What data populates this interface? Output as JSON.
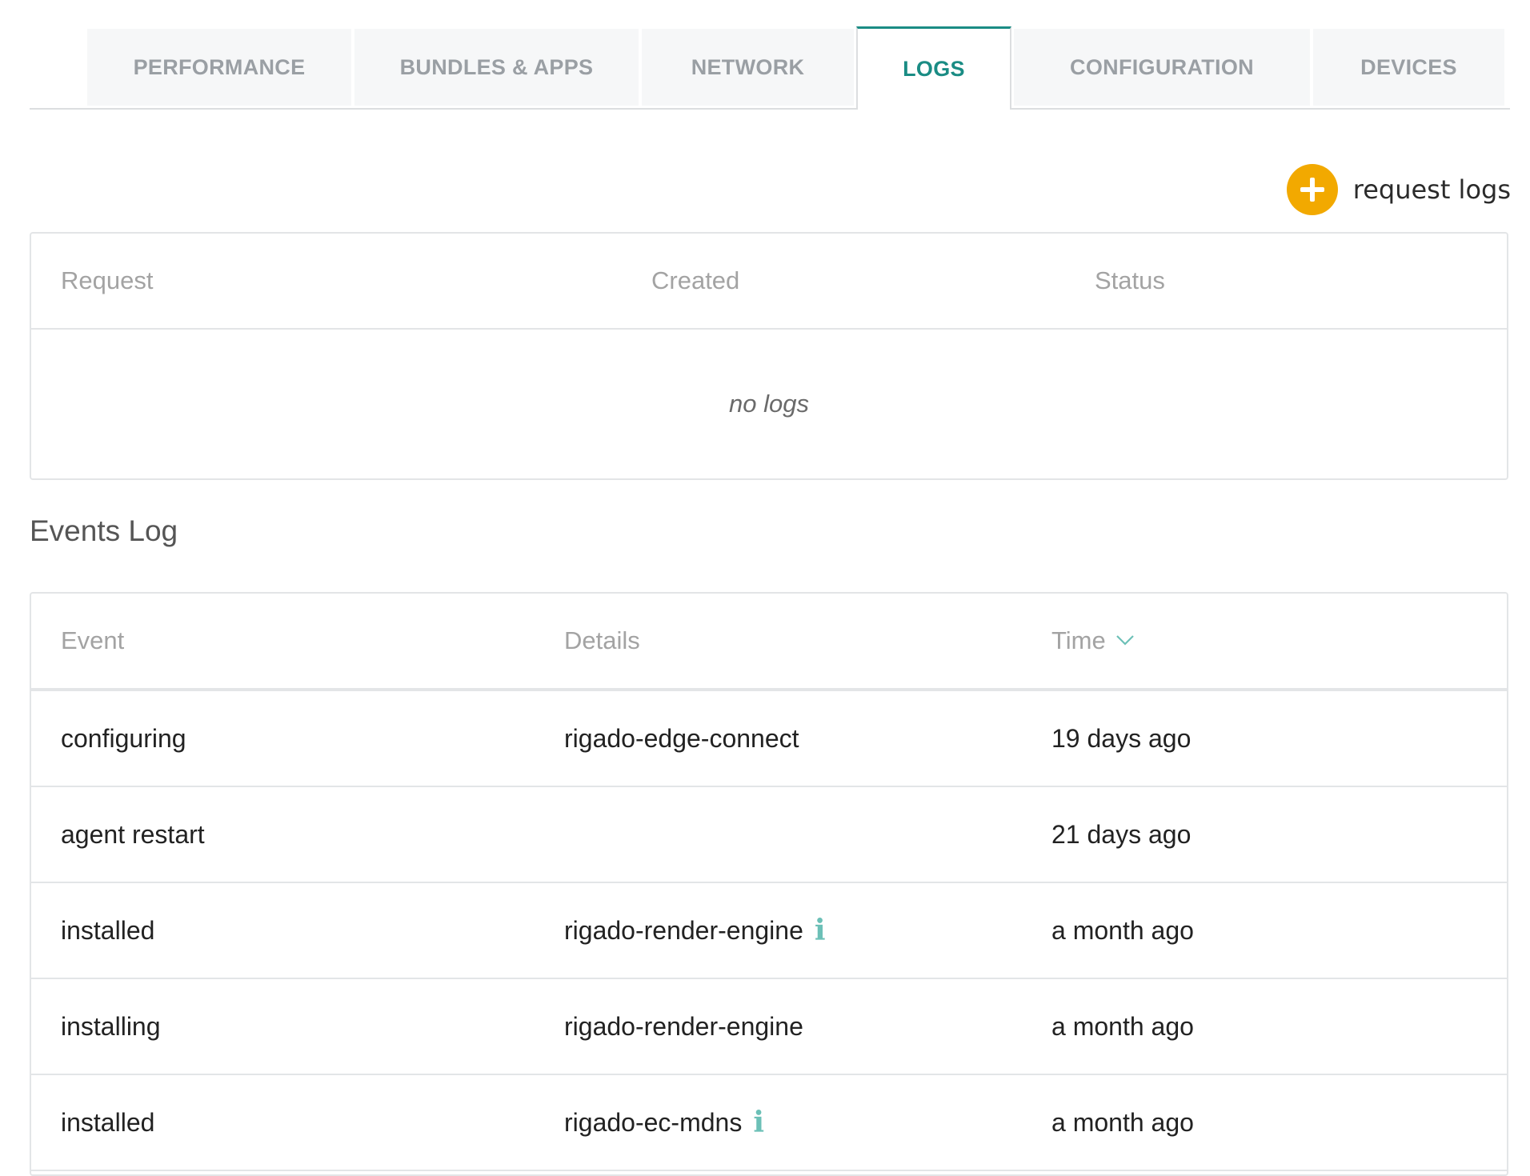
{
  "tabs": [
    {
      "label": "PERFORMANCE",
      "active": false
    },
    {
      "label": "BUNDLES & APPS",
      "active": false
    },
    {
      "label": "NETWORK",
      "active": false
    },
    {
      "label": "LOGS",
      "active": true
    },
    {
      "label": "CONFIGURATION",
      "active": false
    },
    {
      "label": "DEVICES",
      "active": false
    }
  ],
  "actions": {
    "request_logs_label": "request logs",
    "request_logs_icon": "plus-circle-icon"
  },
  "logs_table": {
    "columns": [
      "Request",
      "Created",
      "Status"
    ],
    "empty_text": "no logs"
  },
  "events": {
    "title": "Events Log",
    "columns": [
      "Event",
      "Details",
      "Time"
    ],
    "sort_icon": "chevron-down-icon",
    "rows": [
      {
        "event": "configuring",
        "details": "rigado-edge-connect",
        "time": "19 days ago",
        "info": false
      },
      {
        "event": "agent restart",
        "details": "",
        "time": "21 days ago",
        "info": false
      },
      {
        "event": "installed",
        "details": "rigado-render-engine",
        "time": "a month ago",
        "info": true
      },
      {
        "event": "installing",
        "details": "rigado-render-engine",
        "time": "a month ago",
        "info": false
      },
      {
        "event": "installed",
        "details": "rigado-ec-mdns",
        "time": "a month ago",
        "info": true
      }
    ]
  },
  "colors": {
    "accent": "#1a8c84",
    "button": "#f2a900",
    "info": "#6cc0b7"
  }
}
